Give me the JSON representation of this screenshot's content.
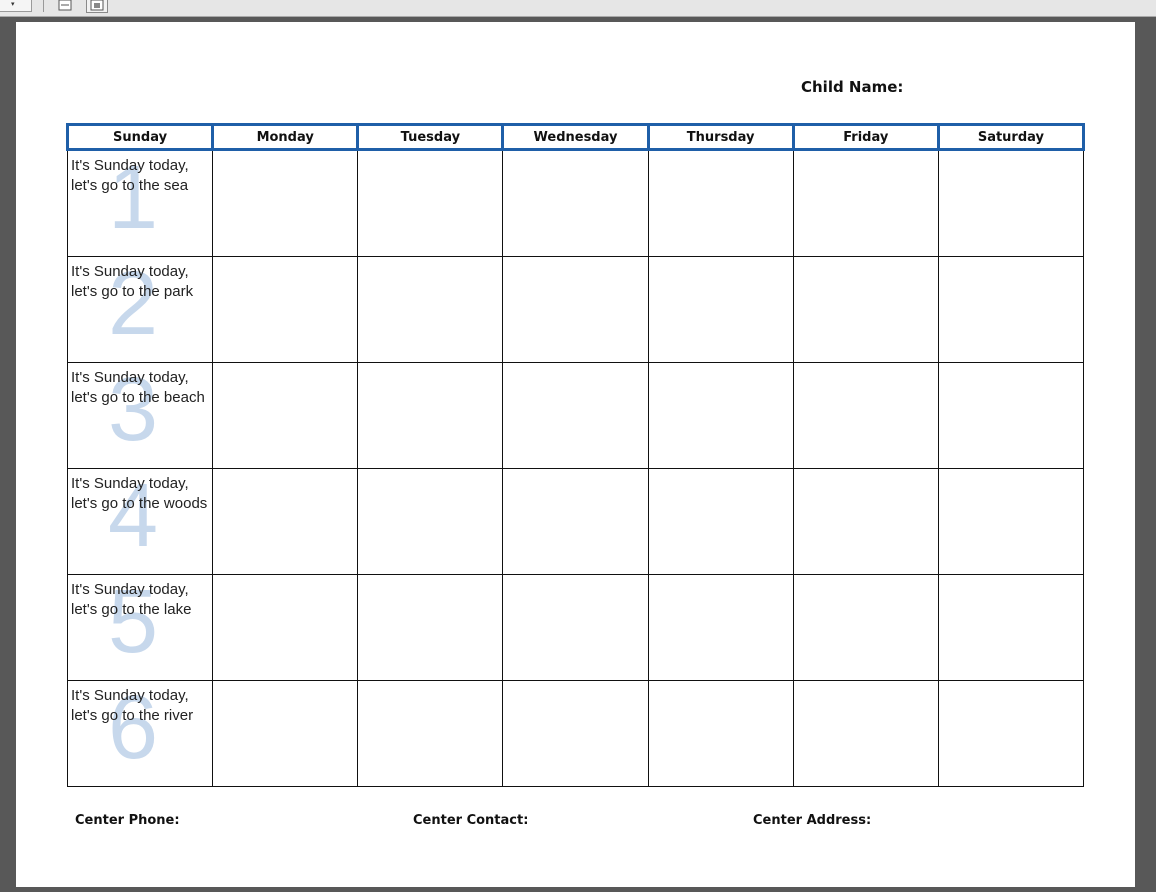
{
  "toolbar": {
    "dropdown_arrow": "▾",
    "icons": [
      "page-fit-icon",
      "fit-width-icon"
    ]
  },
  "form": {
    "child_name_label": "Child Name:",
    "days": [
      "Sunday",
      "Monday",
      "Tuesday",
      "Wednesday",
      "Thursday",
      "Friday",
      "Saturday"
    ],
    "weeks": [
      {
        "number": "1",
        "sunday_text": "It's Sunday today, let's go to the sea"
      },
      {
        "number": "2",
        "sunday_text": "It's Sunday today, let's go to the park"
      },
      {
        "number": "3",
        "sunday_text": "It's Sunday today, let's go to the beach"
      },
      {
        "number": "4",
        "sunday_text": "It's Sunday today, let's go to the woods"
      },
      {
        "number": "5",
        "sunday_text": "It's Sunday today, let's go to the lake"
      },
      {
        "number": "6",
        "sunday_text": "It's Sunday today, let's go to the river"
      }
    ],
    "footer": {
      "phone_label": "Center Phone:",
      "contact_label": "Center Contact:",
      "address_label": "Center Address:"
    }
  },
  "colors": {
    "header_border": "#1f5fa8",
    "watermark_number": "#c7d8ec",
    "viewer_background": "#585858"
  }
}
